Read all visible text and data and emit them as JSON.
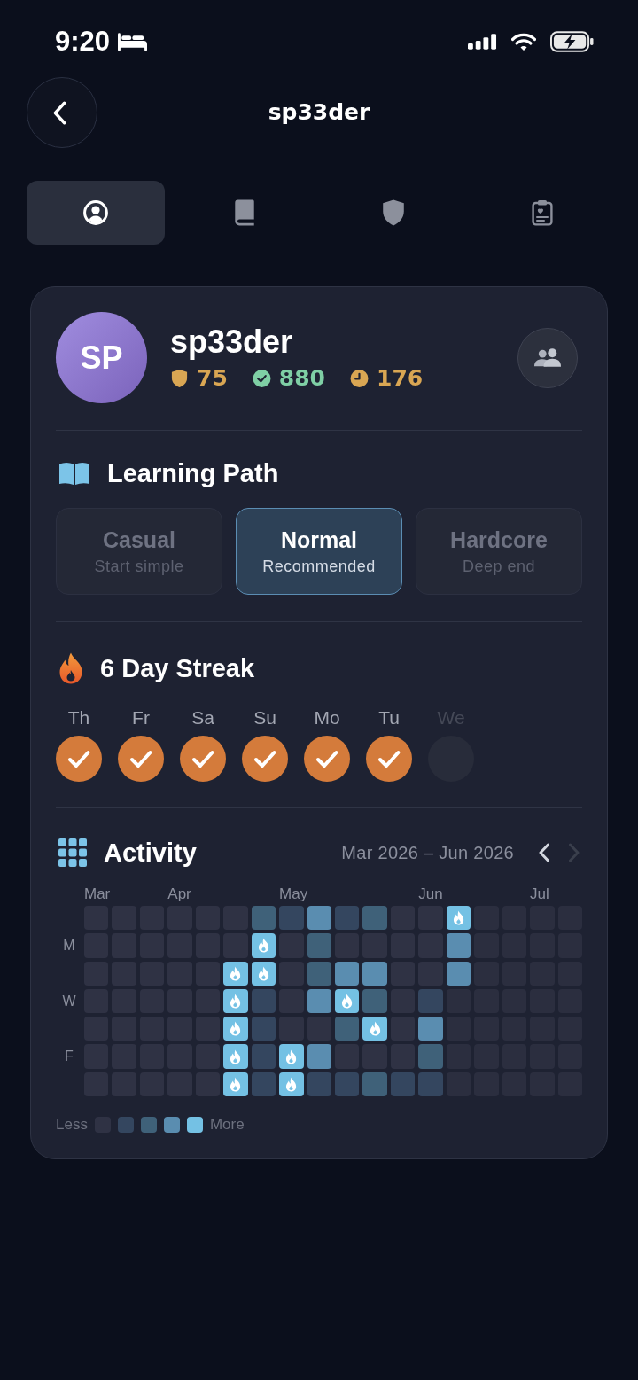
{
  "status_bar": {
    "time": "9:20"
  },
  "header": {
    "title": "sp33der"
  },
  "tabs": [
    {
      "kind": "person",
      "selected": true
    },
    {
      "kind": "book",
      "selected": false
    },
    {
      "kind": "shield",
      "selected": false
    },
    {
      "kind": "clipboard",
      "selected": false
    }
  ],
  "profile": {
    "initials": "SP",
    "name": "sp33der",
    "stats": [
      {
        "kind": "shield",
        "value": "75",
        "color": "#d9a653"
      },
      {
        "kind": "check",
        "value": "880",
        "color": "#7fcfa5"
      },
      {
        "kind": "clock",
        "value": "176",
        "color": "#d9a653"
      }
    ]
  },
  "learning_path": {
    "title": "Learning Path",
    "options": [
      {
        "name": "Casual",
        "subtitle": "Start simple",
        "selected": false
      },
      {
        "name": "Normal",
        "subtitle": "Recommended",
        "selected": true
      },
      {
        "name": "Hardcore",
        "subtitle": "Deep end",
        "selected": false
      }
    ]
  },
  "streak": {
    "title": "6 Day Streak",
    "days": [
      {
        "label": "Th",
        "checked": true
      },
      {
        "label": "Fr",
        "checked": true
      },
      {
        "label": "Sa",
        "checked": true
      },
      {
        "label": "Su",
        "checked": true
      },
      {
        "label": "Mo",
        "checked": true
      },
      {
        "label": "Tu",
        "checked": true
      },
      {
        "label": "We",
        "checked": false
      }
    ]
  },
  "activity": {
    "title": "Activity",
    "range": "Mar 2026 – Jun 2026",
    "previous_button": {
      "disabled": false
    },
    "next_button": {
      "disabled": true
    },
    "weekdays": [
      "M",
      "W",
      "F"
    ],
    "weeks": [
      {
        "month": "Mar",
        "days": [
          {
            "color": "#2f3244",
            "flame": false
          },
          {
            "color": "#2f3244",
            "flame": false
          },
          {
            "color": "#2f3244",
            "flame": false
          },
          {
            "color": "#2f3244",
            "flame": false
          },
          {
            "color": "#2f3244",
            "flame": false
          },
          {
            "color": "#2f3244",
            "flame": false
          },
          {
            "color": "#2f3244",
            "flame": false
          }
        ]
      },
      {
        "days": [
          {
            "color": "#2f3244",
            "flame": false
          },
          {
            "color": "#2f3244",
            "flame": false
          },
          {
            "color": "#2f3244",
            "flame": false
          },
          {
            "color": "#2f3244",
            "flame": false
          },
          {
            "color": "#2f3244",
            "flame": false
          },
          {
            "color": "#2f3244",
            "flame": false
          },
          {
            "color": "#2f3244",
            "flame": false
          }
        ]
      },
      {
        "days": [
          {
            "color": "#2f3244",
            "flame": false
          },
          {
            "color": "#2f3244",
            "flame": false
          },
          {
            "color": "#2f3244",
            "flame": false
          },
          {
            "color": "#2f3244",
            "flame": false
          },
          {
            "color": "#2f3244",
            "flame": false
          },
          {
            "color": "#2f3244",
            "flame": false
          },
          {
            "color": "#2f3244",
            "flame": false
          }
        ]
      },
      {
        "month": "Apr",
        "days": [
          {
            "color": "#2f3244",
            "flame": false
          },
          {
            "color": "#2f3244",
            "flame": false
          },
          {
            "color": "#2f3244",
            "flame": false
          },
          {
            "color": "#2f3244",
            "flame": false
          },
          {
            "color": "#2f3244",
            "flame": false
          },
          {
            "color": "#2f3244",
            "flame": false
          },
          {
            "color": "#2f3244",
            "flame": false
          }
        ]
      },
      {
        "days": [
          {
            "color": "#2f3244",
            "flame": false
          },
          {
            "color": "#2f3244",
            "flame": false
          },
          {
            "color": "#2f3244",
            "flame": false
          },
          {
            "color": "#2f3244",
            "flame": false
          },
          {
            "color": "#2f3244",
            "flame": false
          },
          {
            "color": "#2f3244",
            "flame": false
          },
          {
            "color": "#2f3244",
            "flame": false
          }
        ]
      },
      {
        "days": [
          {
            "color": "#2f3244",
            "flame": false
          },
          {
            "color": "#2f3244",
            "flame": false
          },
          {
            "color": "#74c1e4",
            "flame": true
          },
          {
            "color": "#74c1e4",
            "flame": true
          },
          {
            "color": "#74c1e4",
            "flame": true
          },
          {
            "color": "#74c1e4",
            "flame": true
          },
          {
            "color": "#74c1e4",
            "flame": true
          }
        ]
      },
      {
        "days": [
          {
            "color": "#3f6179",
            "flame": false
          },
          {
            "color": "#74c1e4",
            "flame": true
          },
          {
            "color": "#74c1e4",
            "flame": true
          },
          {
            "color": "#34465f",
            "flame": false
          },
          {
            "color": "#34465f",
            "flame": false
          },
          {
            "color": "#34465f",
            "flame": false
          },
          {
            "color": "#34465f",
            "flame": false
          }
        ]
      },
      {
        "month": "May",
        "days": [
          {
            "color": "#34465f",
            "flame": false
          },
          {
            "color": "#2f3244",
            "flame": false
          },
          {
            "color": "#2f3244",
            "flame": false
          },
          {
            "color": "#2f3244",
            "flame": false
          },
          {
            "color": "#2f3244",
            "flame": false
          },
          {
            "color": "#74c1e4",
            "flame": true
          },
          {
            "color": "#74c1e4",
            "flame": true
          }
        ]
      },
      {
        "days": [
          {
            "color": "#5a8db0",
            "flame": false
          },
          {
            "color": "#3f6179",
            "flame": false
          },
          {
            "color": "#3f6179",
            "flame": false
          },
          {
            "color": "#5a8db0",
            "flame": false
          },
          {
            "color": "#2f3244",
            "flame": false
          },
          {
            "color": "#5a8db0",
            "flame": false
          },
          {
            "color": "#34465f",
            "flame": false
          }
        ]
      },
      {
        "days": [
          {
            "color": "#34465f",
            "flame": false
          },
          {
            "color": "#2f3244",
            "flame": false
          },
          {
            "color": "#5a8db0",
            "flame": false
          },
          {
            "color": "#74c1e4",
            "flame": true
          },
          {
            "color": "#3f6179",
            "flame": false
          },
          {
            "color": "#2f3244",
            "flame": false
          },
          {
            "color": "#34465f",
            "flame": false
          }
        ]
      },
      {
        "days": [
          {
            "color": "#3f6179",
            "flame": false
          },
          {
            "color": "#2f3244",
            "flame": false
          },
          {
            "color": "#5a8db0",
            "flame": false
          },
          {
            "color": "#3f6179",
            "flame": false
          },
          {
            "color": "#74c1e4",
            "flame": true
          },
          {
            "color": "#2f3244",
            "flame": false
          },
          {
            "color": "#3f6179",
            "flame": false
          }
        ]
      },
      {
        "days": [
          {
            "color": "#2f3244",
            "flame": false
          },
          {
            "color": "#2f3244",
            "flame": false
          },
          {
            "color": "#2f3244",
            "flame": false
          },
          {
            "color": "#2f3244",
            "flame": false
          },
          {
            "color": "#2f3244",
            "flame": false
          },
          {
            "color": "#2f3244",
            "flame": false
          },
          {
            "color": "#34465f",
            "flame": false
          }
        ]
      },
      {
        "month": "Jun",
        "days": [
          {
            "color": "#2f3244",
            "flame": false
          },
          {
            "color": "#2f3244",
            "flame": false
          },
          {
            "color": "#2f3244",
            "flame": false
          },
          {
            "color": "#34465f",
            "flame": false
          },
          {
            "color": "#5a8db0",
            "flame": false
          },
          {
            "color": "#3f6179",
            "flame": false
          },
          {
            "color": "#34465f",
            "flame": false
          }
        ]
      },
      {
        "days": [
          {
            "color": "#74c1e4",
            "flame": true
          },
          {
            "color": "#5a8db0",
            "flame": false
          },
          {
            "color": "#5a8db0",
            "flame": false
          },
          {
            "color": "#2b2e3f",
            "flame": false
          },
          {
            "color": "#2b2e3f",
            "flame": false
          },
          {
            "color": "#2b2e3f",
            "flame": false
          },
          {
            "color": "#2b2e3f",
            "flame": false
          }
        ]
      },
      {
        "days": [
          {
            "color": "#2b2e3f",
            "flame": false
          },
          {
            "color": "#2b2e3f",
            "flame": false
          },
          {
            "color": "#2b2e3f",
            "flame": false
          },
          {
            "color": "#2b2e3f",
            "flame": false
          },
          {
            "color": "#2b2e3f",
            "flame": false
          },
          {
            "color": "#2b2e3f",
            "flame": false
          },
          {
            "color": "#2b2e3f",
            "flame": false
          }
        ]
      },
      {
        "days": [
          {
            "color": "#2b2e3f",
            "flame": false
          },
          {
            "color": "#2b2e3f",
            "flame": false
          },
          {
            "color": "#2b2e3f",
            "flame": false
          },
          {
            "color": "#2b2e3f",
            "flame": false
          },
          {
            "color": "#2b2e3f",
            "flame": false
          },
          {
            "color": "#2b2e3f",
            "flame": false
          },
          {
            "color": "#2b2e3f",
            "flame": false
          }
        ]
      },
      {
        "month": "Jul",
        "days": [
          {
            "color": "#2b2e3f",
            "flame": false
          },
          {
            "color": "#2b2e3f",
            "flame": false
          },
          {
            "color": "#2b2e3f",
            "flame": false
          },
          {
            "color": "#2b2e3f",
            "flame": false
          },
          {
            "color": "#2b2e3f",
            "flame": false
          },
          {
            "color": "#2b2e3f",
            "flame": false
          },
          {
            "color": "#2b2e3f",
            "flame": false
          }
        ]
      },
      {
        "days": [
          {
            "color": "#2b2e3f",
            "flame": false
          },
          {
            "color": "#2b2e3f",
            "flame": false
          },
          {
            "color": "#2b2e3f",
            "flame": false
          },
          {
            "color": "#2b2e3f",
            "flame": false
          },
          {
            "color": "#2b2e3f",
            "flame": false
          },
          {
            "color": "#2b2e3f",
            "flame": false
          },
          {
            "color": "#2b2e3f",
            "flame": false
          }
        ]
      }
    ],
    "legend": {
      "less": "Less",
      "more": "More",
      "swatches": [
        {
          "color": "#2f3244"
        },
        {
          "color": "#34465f"
        },
        {
          "color": "#3f6179"
        },
        {
          "color": "#5a8db0"
        },
        {
          "color": "#74c1e4"
        }
      ]
    }
  }
}
